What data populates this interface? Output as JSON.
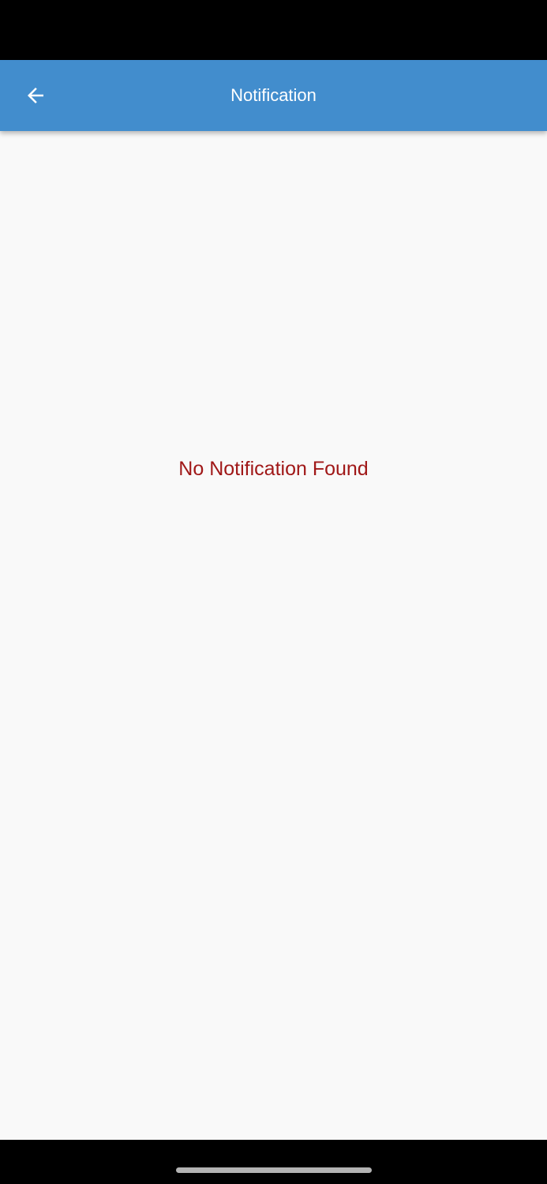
{
  "app_bar": {
    "title": "Notification",
    "back_icon": "arrow-left-icon",
    "background_color": "#428dcd"
  },
  "content": {
    "empty_message": "No Notification Found",
    "empty_message_color": "#a01818",
    "background_color": "#f9f9f9"
  }
}
